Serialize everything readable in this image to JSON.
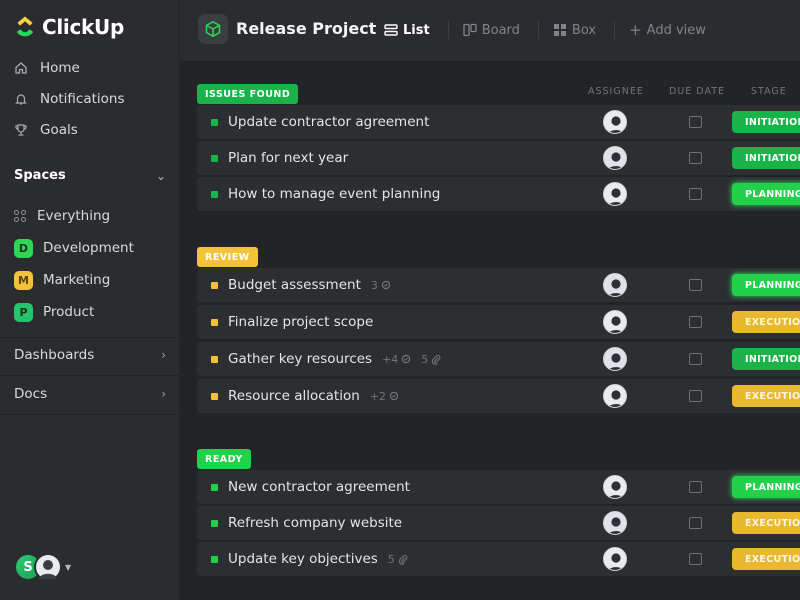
{
  "app": {
    "name": "ClickUp",
    "logo_icon": "clickup-logo-icon"
  },
  "sidebar": {
    "nav": [
      {
        "label": "Home",
        "icon": "home-icon"
      },
      {
        "label": "Notifications",
        "icon": "bell-icon"
      },
      {
        "label": "Goals",
        "icon": "trophy-icon"
      }
    ],
    "spaces_label": "Spaces",
    "spaces": [
      {
        "label": "Everything",
        "icon": "everything-icon"
      },
      {
        "label": "Development",
        "badge": "D",
        "color": "#2fd653"
      },
      {
        "label": "Marketing",
        "badge": "M",
        "color": "#f2c23a"
      },
      {
        "label": "Product",
        "badge": "P",
        "color": "#25c46a"
      }
    ],
    "dashboards_label": "Dashboards",
    "docs_label": "Docs",
    "user_initial": "S"
  },
  "header": {
    "project_title": "Release Project",
    "project_icon": "cube-icon",
    "views": [
      {
        "label": "List",
        "icon": "list-icon",
        "active": true
      },
      {
        "label": "Board",
        "icon": "board-icon",
        "active": false
      },
      {
        "label": "Box",
        "icon": "box-icon",
        "active": false
      },
      {
        "label": "Add view",
        "icon": "plus-icon",
        "active": false
      }
    ]
  },
  "columns": {
    "assignee": "ASSIGNEE",
    "due_date": "DUE DATE",
    "stage": "STAGE"
  },
  "groups": [
    {
      "label": "ISSUES FOUND",
      "color": "#19b34a",
      "tasks": [
        {
          "name": "Update contractor agreement",
          "stage": "INITIATION",
          "subtasks": "",
          "attachments": ""
        },
        {
          "name": "Plan for next year",
          "stage": "INITIATION",
          "subtasks": "",
          "attachments": ""
        },
        {
          "name": "How to manage event planning",
          "stage": "PLANNING",
          "subtasks": "",
          "attachments": ""
        }
      ]
    },
    {
      "label": "REVIEW",
      "color": "#f2c23a",
      "tasks": [
        {
          "name": "Budget assessment",
          "stage": "PLANNING",
          "subtasks": "3",
          "attachments": ""
        },
        {
          "name": "Finalize project scope",
          "stage": "EXECUTION",
          "subtasks": "",
          "attachments": ""
        },
        {
          "name": "Gather key resources",
          "stage": "INITIATION",
          "subtasks": "+4",
          "attachments": "5"
        },
        {
          "name": "Resource allocation",
          "stage": "EXECUTION",
          "subtasks": "+2",
          "attachments": ""
        }
      ]
    },
    {
      "label": "READY",
      "color": "#22d04a",
      "tasks": [
        {
          "name": "New contractor agreement",
          "stage": "PLANNING",
          "subtasks": "",
          "attachments": ""
        },
        {
          "name": "Refresh company website",
          "stage": "EXECUTION",
          "subtasks": "",
          "attachments": ""
        },
        {
          "name": "Update key objectives",
          "stage": "EXECUTION",
          "subtasks": "",
          "attachments": "5"
        }
      ]
    }
  ]
}
